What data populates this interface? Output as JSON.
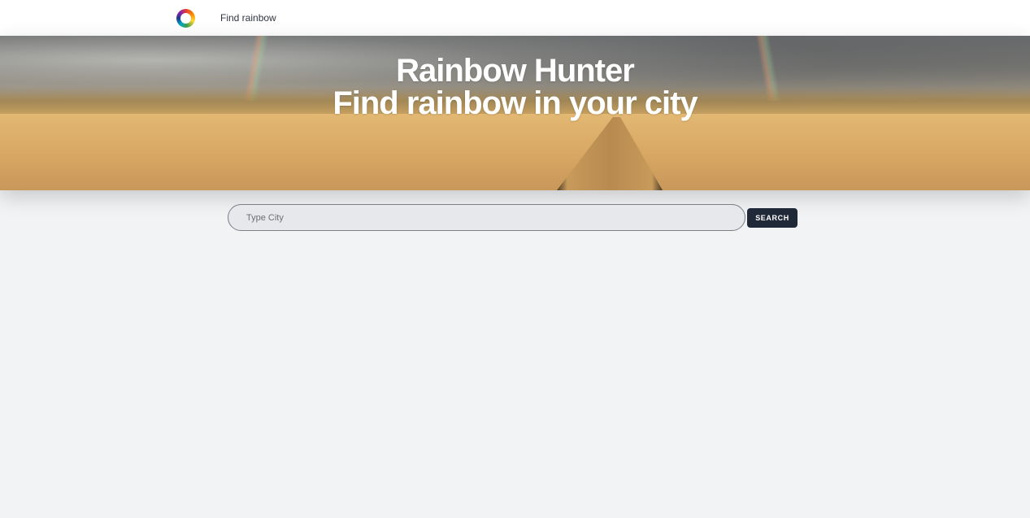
{
  "nav": {
    "logo_icon": "rainbow-ring-icon",
    "link_label": "Find rainbow"
  },
  "hero": {
    "title": "Rainbow Hunter",
    "subtitle": "Find rainbow in your city"
  },
  "search": {
    "placeholder": "Type City",
    "value": "",
    "button_label": "SEARCH"
  },
  "colors": {
    "page_background": "#f2f3f5",
    "nav_background": "#ffffff",
    "button_background": "#1f2937",
    "input_background": "#e6e8eb"
  }
}
